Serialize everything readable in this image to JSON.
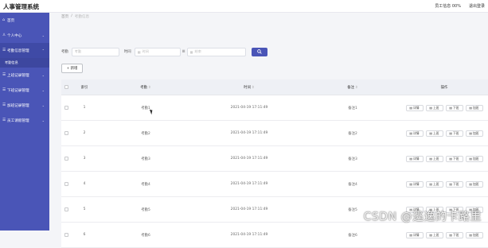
{
  "header": {
    "title": "人事管理系统",
    "user_label": "员工信息 00%",
    "logout_label": "退出登录"
  },
  "sidebar": {
    "items": [
      {
        "label": "首页",
        "icon": "home-icon",
        "has_chevron": false
      },
      {
        "label": "个人中心",
        "icon": "user-icon",
        "has_chevron": true
      },
      {
        "label": "考勤信息管理",
        "icon": "list-icon",
        "has_chevron": true,
        "active": true
      },
      {
        "label": "上班记录管理",
        "icon": "list-icon",
        "has_chevron": true
      },
      {
        "label": "下班记录管理",
        "icon": "list-icon",
        "has_chevron": true
      },
      {
        "label": "加班记录管理",
        "icon": "list-icon",
        "has_chevron": true
      },
      {
        "label": "员工请假管理",
        "icon": "list-icon",
        "has_chevron": true
      }
    ],
    "sub_item": "考勤信息"
  },
  "breadcrumb": {
    "home": "首页",
    "separator": "/",
    "current": "考勤信息"
  },
  "search": {
    "field1_label": "考勤",
    "field1_placeholder": "考勤",
    "field2_label": "时间",
    "field2_placeholder": "时间",
    "field3_placeholder": "结束",
    "button_icon": "search-icon"
  },
  "toolbar": {
    "add_label": "+ 新增"
  },
  "table": {
    "columns": [
      "",
      "索引",
      "考勤",
      "时间",
      "备注",
      "操作"
    ],
    "rows": [
      {
        "idx": "1",
        "name": "考勤1",
        "time": "2021-04-19 17:11:49",
        "note": "备注1"
      },
      {
        "idx": "2",
        "name": "考勤2",
        "time": "2021-04-19 17:11:49",
        "note": "备注2"
      },
      {
        "idx": "3",
        "name": "考勤3",
        "time": "2021-04-19 17:11:49",
        "note": "备注3"
      },
      {
        "idx": "4",
        "name": "考勤4",
        "time": "2021-04-19 17:11:49",
        "note": "备注4"
      },
      {
        "idx": "5",
        "name": "考勤5",
        "time": "2021-04-19 17:11:49",
        "note": "备注5"
      },
      {
        "idx": "6",
        "name": "考勤6",
        "time": "2021-04-19 17:11:49",
        "note": "备注6"
      }
    ],
    "actions": [
      "详情",
      "上班",
      "下班",
      "加班"
    ]
  },
  "watermark": "CSDN @逃逸的卡路里",
  "colors": {
    "sidebar": "#4a55b7",
    "primary": "#4a55b7",
    "background": "#f4f5f8"
  }
}
